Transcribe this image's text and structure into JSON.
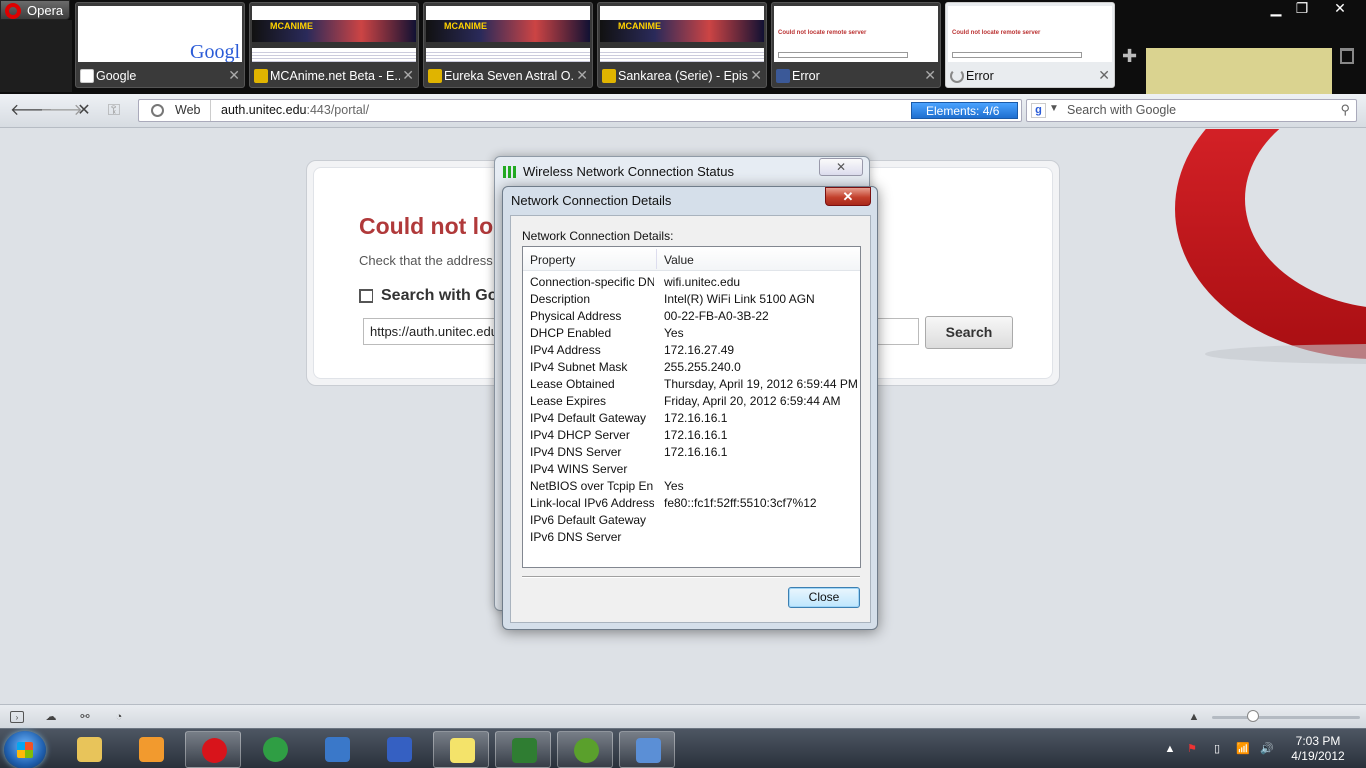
{
  "browser": {
    "menu_label": "Opera",
    "tabs": [
      {
        "title": "Google",
        "favicon": "google-icon",
        "thumb_text": "Googl"
      },
      {
        "title": "MCAnime.net Beta - E...",
        "favicon": "mcanime-icon",
        "thumb_text": "MCANIME"
      },
      {
        "title": "Eureka Seven Astral O...",
        "favicon": "mcanime-icon",
        "thumb_text": "MCANIME"
      },
      {
        "title": "Sankarea (Serie) - Epis...",
        "favicon": "mcanime-icon",
        "thumb_text": "MCANIME"
      },
      {
        "title": "Error",
        "favicon": "facebook-icon",
        "thumb_text": "Could not locate remote server"
      },
      {
        "title": "Error",
        "favicon": "loading-icon",
        "thumb_text": "Could not locate remote server",
        "active": true
      }
    ],
    "address": {
      "site_label": "Web",
      "url_host": "auth.unitec.edu",
      "url_rest": ":443/portal/",
      "url_prefix": ""
    },
    "elements_badge": "Elements:  4/6",
    "search_placeholder": "Search with Google"
  },
  "error_page": {
    "title": "Could not lo",
    "subtitle": "Check that the address",
    "search_heading": "Search with Go",
    "search_value": "https://auth.unitec.edu",
    "search_button": "Search"
  },
  "status_dialog": {
    "title": "Wireless Network Connection Status",
    "close_glyph": "✕"
  },
  "details_dialog": {
    "title": "Network Connection Details",
    "close_glyph": "✕",
    "group_label": "Network Connection Details:",
    "columns": [
      "Property",
      "Value"
    ],
    "rows": [
      {
        "property": "Connection-specific DN...",
        "value": "wifi.unitec.edu"
      },
      {
        "property": "Description",
        "value": "Intel(R) WiFi Link 5100 AGN"
      },
      {
        "property": "Physical Address",
        "value": "00-22-FB-A0-3B-22"
      },
      {
        "property": "DHCP Enabled",
        "value": "Yes"
      },
      {
        "property": "IPv4 Address",
        "value": "172.16.27.49"
      },
      {
        "property": "IPv4 Subnet Mask",
        "value": "255.255.240.0"
      },
      {
        "property": "Lease Obtained",
        "value": "Thursday, April 19, 2012 6:59:44 PM"
      },
      {
        "property": "Lease Expires",
        "value": "Friday, April 20, 2012 6:59:44 AM"
      },
      {
        "property": "IPv4 Default Gateway",
        "value": "172.16.16.1"
      },
      {
        "property": "IPv4 DHCP Server",
        "value": "172.16.16.1"
      },
      {
        "property": "IPv4 DNS Server",
        "value": "172.16.16.1"
      },
      {
        "property": "IPv4 WINS Server",
        "value": ""
      },
      {
        "property": "NetBIOS over Tcpip En...",
        "value": "Yes"
      },
      {
        "property": "Link-local IPv6 Address",
        "value": "fe80::fc1f:52ff:5510:3cf7%12"
      },
      {
        "property": "IPv6 Default Gateway",
        "value": ""
      },
      {
        "property": "IPv6 DNS Server",
        "value": ""
      }
    ],
    "close_button": "Close"
  },
  "taskbar": {
    "time": "7:03 PM",
    "date": "4/19/2012",
    "apps": [
      {
        "name": "explorer",
        "icon": "folder-icon",
        "color": "#e8c45a"
      },
      {
        "name": "media-player",
        "icon": "media-player-icon",
        "color": "#f29a2e"
      },
      {
        "name": "opera",
        "icon": "opera-icon",
        "color": "#d8141b",
        "running": true
      },
      {
        "name": "chrome",
        "icon": "chrome-icon",
        "color": "#2f9e44"
      },
      {
        "name": "remote-desktop",
        "icon": "remote-desktop-icon",
        "color": "#3a78c9"
      },
      {
        "name": "infinity-app",
        "icon": "infinity-icon",
        "color": "#3560c2"
      },
      {
        "name": "sticky-notes",
        "icon": "sticky-notes-icon",
        "color": "#f4e36a",
        "running": true
      },
      {
        "name": "terminal",
        "icon": "terminal-icon",
        "color": "#2f7d32",
        "running": true
      },
      {
        "name": "earth",
        "icon": "globe-icon",
        "color": "#5aa02c",
        "running": true
      },
      {
        "name": "network-center",
        "icon": "network-center-icon",
        "color": "#5b8fd6",
        "running": true
      }
    ]
  },
  "colors": {
    "error_title": "#b0393a",
    "elements_badge": "#1f6fcf",
    "opera_red": "#d8141b",
    "close_red": "#c2402c"
  }
}
